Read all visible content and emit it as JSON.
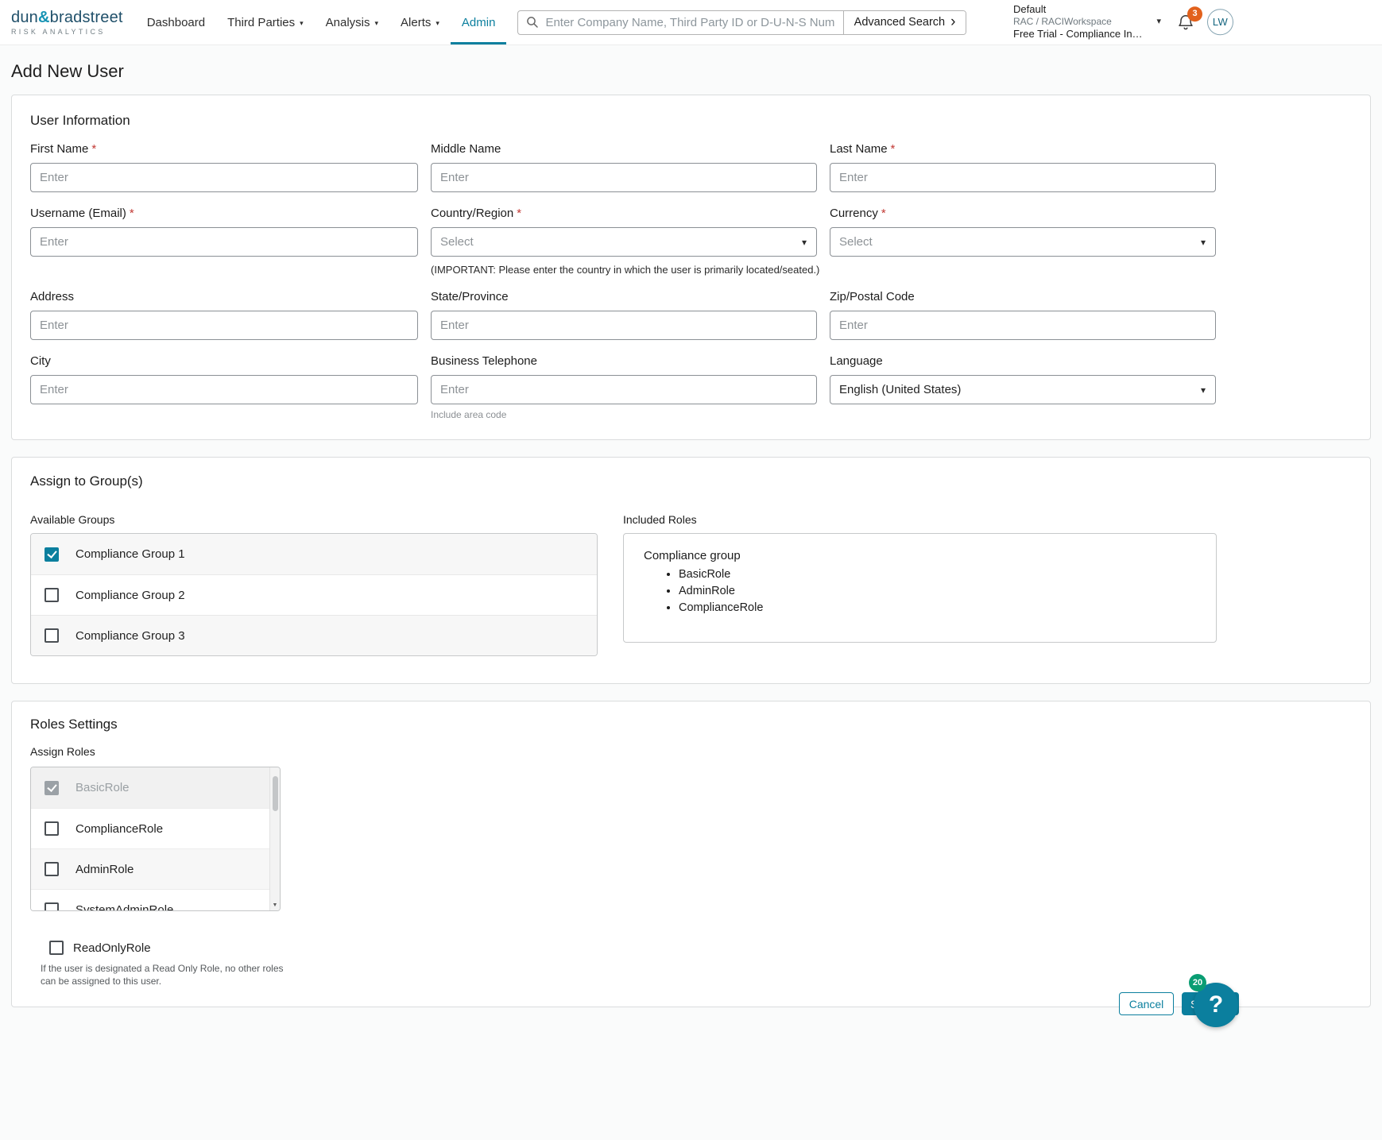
{
  "colors": {
    "accent_teal": "#0b7f9e",
    "badge_orange": "#e2611c",
    "badge_green": "#0a9d73",
    "required_red": "#c23934"
  },
  "icons": {
    "caret_down": "▾",
    "chevron_right": "›",
    "scroll_down": "▼"
  },
  "header": {
    "brand": {
      "word1": "dun",
      "ampersand": "&",
      "word2": "bradstreet",
      "subtitle": "RISK ANALYTICS"
    },
    "nav": [
      {
        "label": "Dashboard",
        "caret": false,
        "active": false
      },
      {
        "label": "Third Parties",
        "caret": true,
        "active": false
      },
      {
        "label": "Analysis",
        "caret": true,
        "active": false
      },
      {
        "label": "Alerts",
        "caret": true,
        "active": false
      },
      {
        "label": "Admin",
        "caret": false,
        "active": true
      }
    ],
    "search": {
      "placeholder": "Enter Company Name, Third Party ID or D-U-N-S Number",
      "advanced_label": "Advanced Search"
    },
    "workspace": {
      "name": "Default",
      "path": "RAC / RACIWorkspace",
      "trial": "Free Trial - Compliance In…"
    },
    "notifications_count": "3",
    "avatar_initials": "LW"
  },
  "page": {
    "title": "Add New User"
  },
  "misc": {
    "required_marker": "*"
  },
  "user_information": {
    "title": "User Information",
    "fields": [
      {
        "label": "First Name",
        "required": true,
        "control": "input",
        "placeholder": "Enter"
      },
      {
        "label": "Middle Name",
        "required": false,
        "control": "input",
        "placeholder": "Enter"
      },
      {
        "label": "Last Name",
        "required": true,
        "control": "input",
        "placeholder": "Enter"
      },
      {
        "label": "Username (Email)",
        "required": true,
        "control": "input",
        "placeholder": "Enter"
      },
      {
        "label": "Country/Region",
        "required": true,
        "control": "select",
        "placeholder": "Select",
        "helper": "(IMPORTANT: Please enter the country in which the user is primarily located/seated.)"
      },
      {
        "label": "Currency",
        "required": true,
        "control": "select",
        "placeholder": "Select"
      },
      {
        "label": "Address",
        "required": false,
        "control": "input",
        "placeholder": "Enter"
      },
      {
        "label": "State/Province",
        "required": false,
        "control": "input",
        "placeholder": "Enter"
      },
      {
        "label": "Zip/Postal Code",
        "required": false,
        "control": "input",
        "placeholder": "Enter"
      },
      {
        "label": "City",
        "required": false,
        "control": "input",
        "placeholder": "Enter"
      },
      {
        "label": "Business Telephone",
        "required": false,
        "control": "input",
        "placeholder": "Enter",
        "helper": "Include area code"
      },
      {
        "label": "Language",
        "required": false,
        "control": "select",
        "value": "English (United States)"
      }
    ]
  },
  "groups": {
    "title": "Assign to Group(s)",
    "available_label": "Available Groups",
    "items": [
      {
        "label": "Compliance Group 1",
        "checked": true
      },
      {
        "label": "Compliance Group 2",
        "checked": false
      },
      {
        "label": "Compliance Group 3",
        "checked": false
      }
    ],
    "included_label": "Included Roles",
    "included": {
      "group_name": "Compliance group",
      "roles": [
        "BasicRole",
        "AdminRole",
        "ComplianceRole"
      ]
    }
  },
  "roles": {
    "title": "Roles Settings",
    "assign_label": "Assign Roles",
    "options": [
      {
        "label": "BasicRole",
        "checked": true,
        "disabled": true
      },
      {
        "label": "ComplianceRole",
        "checked": false,
        "disabled": false
      },
      {
        "label": "AdminRole",
        "checked": false,
        "disabled": false
      },
      {
        "label": "SystemAdminRole",
        "checked": false,
        "disabled": false
      }
    ],
    "read_only": {
      "label": "ReadOnlyRole",
      "checked": false,
      "helper": "If the user is designated a Read Only Role, no other roles can be assigned to this user."
    }
  },
  "footer": {
    "cancel_label": "Cancel",
    "save_label": "Save"
  },
  "help_widget": {
    "badge": "20",
    "icon": "?"
  }
}
